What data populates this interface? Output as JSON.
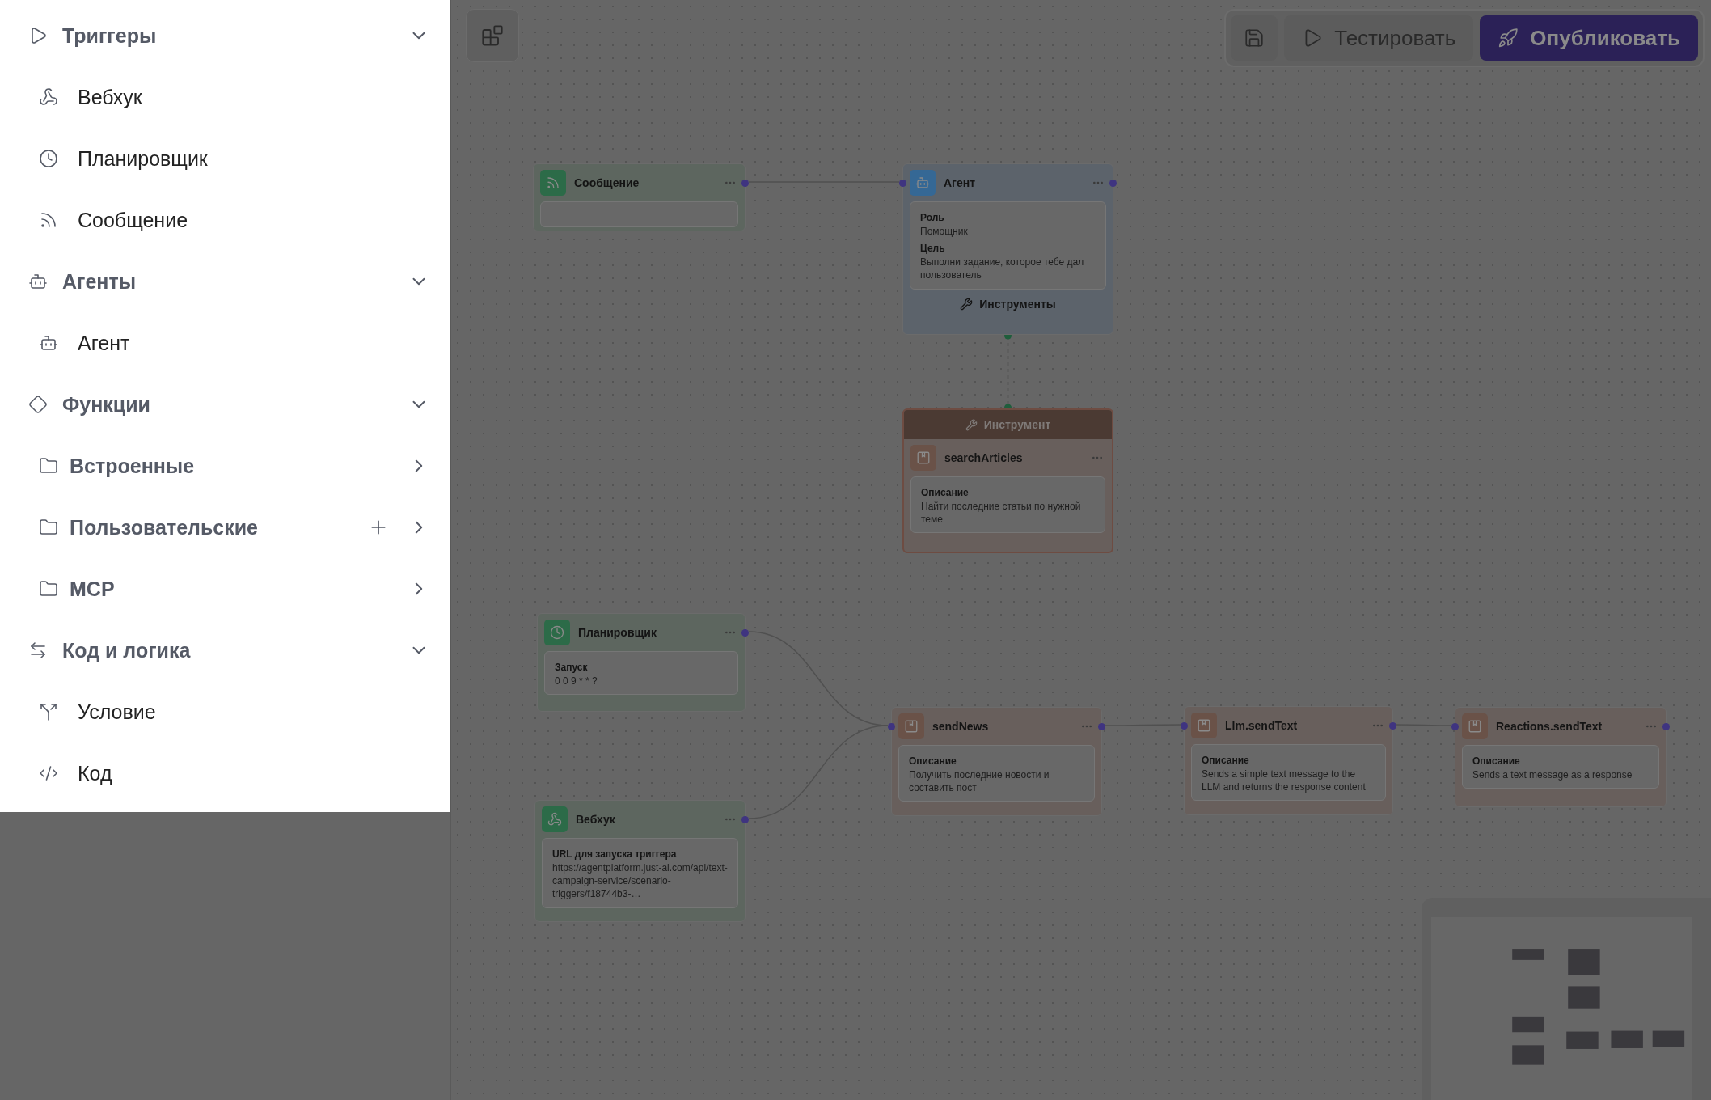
{
  "menu": {
    "sections": [
      {
        "title": "Триггеры",
        "kind": "triggers",
        "expanded": true,
        "items": [
          {
            "label": "Вебхук",
            "kind": "webhook"
          },
          {
            "label": "Планировщик",
            "kind": "scheduler"
          },
          {
            "label": "Сообщение",
            "kind": "message"
          }
        ]
      },
      {
        "title": "Агенты",
        "kind": "agents",
        "expanded": true,
        "items": [
          {
            "label": "Агент",
            "kind": "agent"
          }
        ]
      },
      {
        "title": "Функции",
        "kind": "functions",
        "expanded": true,
        "items": [
          {
            "label": "Встроенные",
            "kind": "folder",
            "addable": false,
            "expanded": false
          },
          {
            "label": "Пользовательские",
            "kind": "folder",
            "addable": true,
            "expanded": false
          },
          {
            "label": "MCP",
            "kind": "folder",
            "addable": false,
            "expanded": false
          }
        ]
      },
      {
        "title": "Код и логика",
        "kind": "logic",
        "expanded": true,
        "items": [
          {
            "label": "Условие",
            "kind": "condition"
          },
          {
            "label": "Код",
            "kind": "code"
          }
        ]
      }
    ]
  },
  "toolbar": {
    "test_label": "Тестировать",
    "publish_label": "Опубликовать"
  },
  "nodes": [
    {
      "kind": "message",
      "title": "Сообщение"
    },
    {
      "kind": "agent",
      "title": "Агент",
      "fields": [
        {
          "label": "Роль",
          "value": "Помощник"
        },
        {
          "label": "Цель",
          "value": "Выполни задание, которое тебе дал пользователь"
        }
      ],
      "footer": "Инструменты"
    },
    {
      "kind": "tool",
      "banner": "Инструмент",
      "title": "searchArticles",
      "fields": [
        {
          "label": "Описание",
          "value": "Найти последние статьи по нужной теме"
        }
      ]
    },
    {
      "kind": "scheduler",
      "title": "Планировщик",
      "fields": [
        {
          "label": "Запуск",
          "value": "0 0 9 * * ?"
        }
      ]
    },
    {
      "kind": "webhook",
      "title": "Вебхук",
      "fields": [
        {
          "label": "URL для запуска триггера",
          "value": "https://agentplatform.just-ai.com/api/text-campaign-service/scenario-triggers/f18744b3-…"
        }
      ]
    },
    {
      "kind": "function",
      "title": "sendNews",
      "fields": [
        {
          "label": "Описание",
          "value": "Получить последние новости и составить пост"
        }
      ]
    },
    {
      "kind": "function",
      "title": "Llm.sendText",
      "fields": [
        {
          "label": "Описание",
          "value": "Sends a simple text message to the LLM and returns the response content"
        }
      ]
    },
    {
      "kind": "function",
      "title": "Reactions.sendText",
      "fields": [
        {
          "label": "Описание",
          "value": "Sends a text message as a response"
        }
      ]
    }
  ]
}
